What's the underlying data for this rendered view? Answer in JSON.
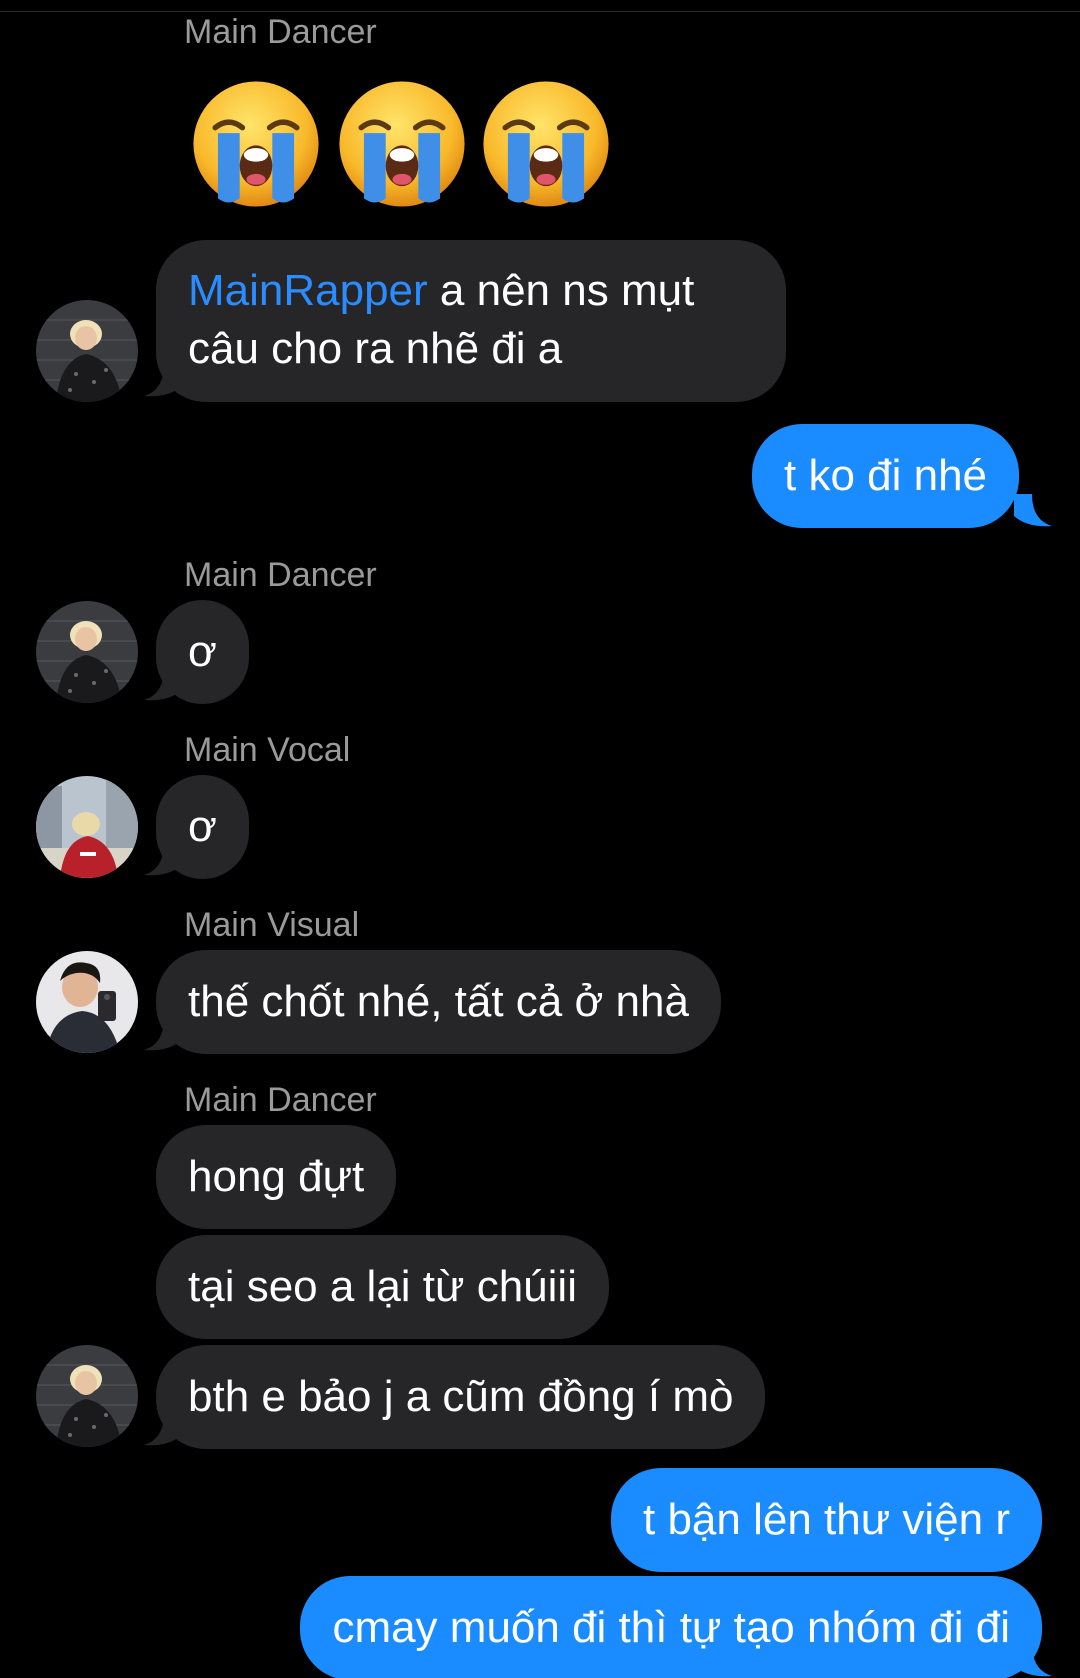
{
  "messages": {
    "sender_dancer_1": "Main Dancer",
    "emoji_names": [
      "loudly-crying-face",
      "loudly-crying-face",
      "loudly-crying-face"
    ],
    "msg1_mention": "MainRapper",
    "msg1_rest_line1": " a nên ns mụt",
    "msg1_line2": "câu cho ra nhẽ đi a",
    "out1": "t ko đi nhé",
    "sender_dancer_2": "Main Dancer",
    "msg2": "ơ",
    "sender_vocal": "Main Vocal",
    "msg3": "ơ",
    "sender_visual": "Main Visual",
    "msg4": "thế chốt nhé, tất cả ở nhà",
    "sender_dancer_3": "Main Dancer",
    "msg5": "hong đựt",
    "msg6": "tại seo a lại từ chúiii",
    "msg7": "bth e bảo j a cũm đồng í mò",
    "out2": "t bận lên thư viện r",
    "out3": "cmay muốn đi thì tự tạo nhóm đi đi"
  },
  "colors": {
    "incoming_bubble": "#262628",
    "outgoing_bubble": "#1a8cff",
    "mention": "#2a8cff",
    "sender_name": "#9a9a9a",
    "background": "#000000"
  }
}
